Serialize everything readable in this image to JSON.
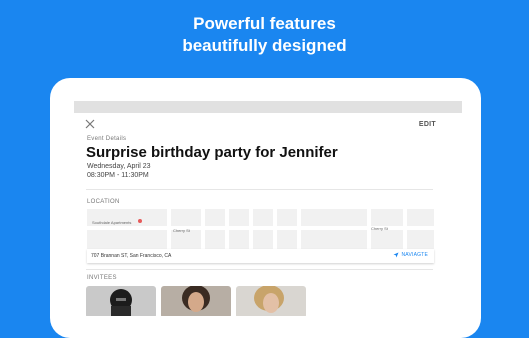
{
  "promo": {
    "line1": "Powerful features",
    "line2": "beautifully designed"
  },
  "header": {
    "edit_label": "EDIT",
    "close_icon": "close-icon"
  },
  "event": {
    "section_label": "Event Details",
    "title": "Surprise birthday party for Jennifer",
    "date": "Wednesday, April 23",
    "time": "08:30PM - 11:30PM"
  },
  "location": {
    "section_label": "LOCATION",
    "map_labels": {
      "apartments": "Southdale Apartments",
      "street_left": "Cherry St",
      "street_right": "Cherry St"
    },
    "address": "707 Brannan ST, San Francisco, CA",
    "navigate_label": "NAVIAGTE",
    "navigate_icon": "navigation-arrow-icon"
  },
  "invitees": {
    "section_label": "INVITEES",
    "count_visible": 3
  },
  "colors": {
    "background": "#1a86f0",
    "accent": "#1a86f0",
    "pin": "#e65a5a"
  }
}
